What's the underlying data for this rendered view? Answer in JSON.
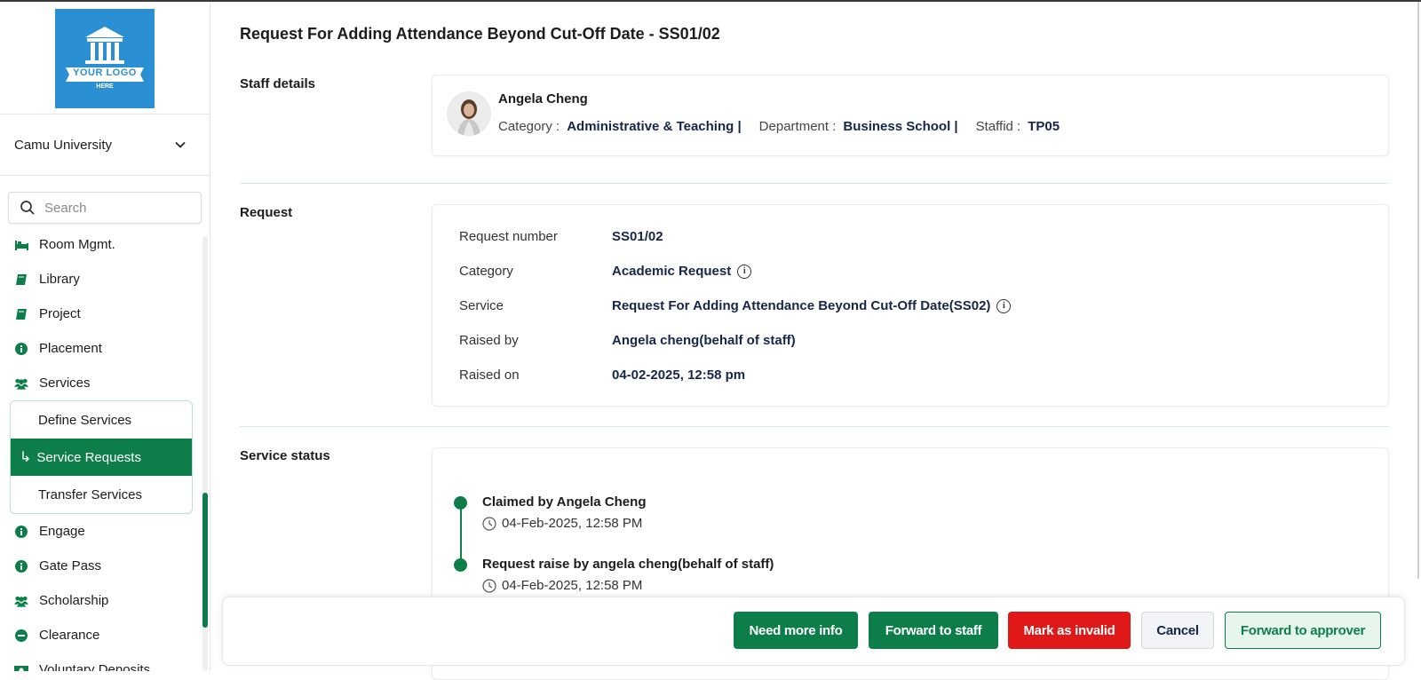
{
  "sidebar": {
    "logo_text": "YOUR LOGO",
    "logo_subtext": "HERE",
    "university": "Camu University",
    "search_placeholder": "Search",
    "items_top": [
      {
        "label": "Room Mgmt.",
        "icon": "bed-icon"
      },
      {
        "label": "Library",
        "icon": "book-icon"
      },
      {
        "label": "Project",
        "icon": "book-icon"
      },
      {
        "label": "Placement",
        "icon": "info-icon"
      },
      {
        "label": "Services",
        "icon": "users-icon"
      }
    ],
    "submenu": [
      {
        "label": "Define Services",
        "active": false
      },
      {
        "label": "Service Requests",
        "active": true
      },
      {
        "label": "Transfer Services",
        "active": false
      }
    ],
    "items_bottom": [
      {
        "label": "Engage",
        "icon": "info-icon"
      },
      {
        "label": "Gate Pass",
        "icon": "info-icon"
      },
      {
        "label": "Scholarship",
        "icon": "users-icon"
      },
      {
        "label": "Clearance",
        "icon": "minus-circle-icon"
      },
      {
        "label": "Voluntary Deposits",
        "icon": "money-icon"
      }
    ]
  },
  "page": {
    "title": "Request For Adding Attendance Beyond Cut-Off Date - SS01/02"
  },
  "staff": {
    "section_label": "Staff details",
    "name": "Angela Cheng",
    "category_label": "Category :",
    "category_value": "Administrative & Teaching |",
    "department_label": "Department :",
    "department_value": "Business School |",
    "staffid_label": "Staffid :",
    "staffid_value": "TP05"
  },
  "request": {
    "section_label": "Request",
    "rows": [
      {
        "label": "Request number",
        "value": "SS01/02",
        "info": false
      },
      {
        "label": "Category",
        "value": "Academic Request",
        "info": true
      },
      {
        "label": "Service",
        "value": "Request For Adding Attendance Beyond Cut-Off Date(SS02)",
        "info": true
      },
      {
        "label": "Raised by",
        "value": "Angela cheng(behalf of staff)",
        "info": false
      },
      {
        "label": "Raised on",
        "value": "04-02-2025, 12:58 pm",
        "info": false
      }
    ]
  },
  "status": {
    "section_label": "Service status",
    "events": [
      {
        "title": "Claimed by Angela Cheng",
        "time": "04-Feb-2025, 12:58 PM"
      },
      {
        "title": "Request raise by angela cheng(behalf of staff)",
        "time": "04-Feb-2025, 12:58 PM"
      }
    ]
  },
  "actions": {
    "need_more_info": "Need more info",
    "forward_to_staff": "Forward to staff",
    "mark_invalid": "Mark as invalid",
    "cancel": "Cancel",
    "forward_to_approver": "Forward to approver"
  },
  "colors": {
    "primary_green": "#0d7e4a",
    "danger_red": "#e01818",
    "logo_blue": "#2b8fd3",
    "value_navy": "#16264a"
  }
}
